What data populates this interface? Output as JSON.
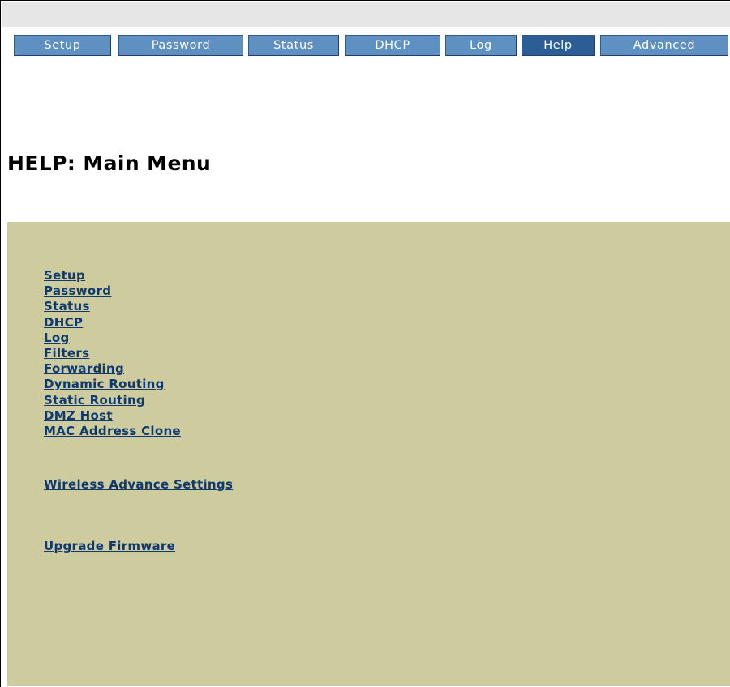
{
  "nav": {
    "tabs": [
      {
        "label": "Setup",
        "active": false
      },
      {
        "label": "Password",
        "active": false
      },
      {
        "label": "Status",
        "active": false
      },
      {
        "label": "DHCP",
        "active": false
      },
      {
        "label": "Log",
        "active": false
      },
      {
        "label": "Help",
        "active": true
      },
      {
        "label": "Advanced",
        "active": false
      }
    ]
  },
  "page": {
    "title": "HELP: Main Menu"
  },
  "help_menu": {
    "links": [
      "Setup",
      "Password",
      "Status",
      "DHCP",
      "Log",
      "Filters",
      "Forwarding",
      "Dynamic Routing",
      "Static Routing",
      "DMZ Host",
      "MAC Address Clone",
      "Wireless Advance Settings",
      "Upgrade Firmware"
    ]
  },
  "colors": {
    "tab_bg": "#5f90c2",
    "tab_active_bg": "#2c5e95",
    "panel_bg": "#cecc9f",
    "link": "#0f3a70"
  }
}
